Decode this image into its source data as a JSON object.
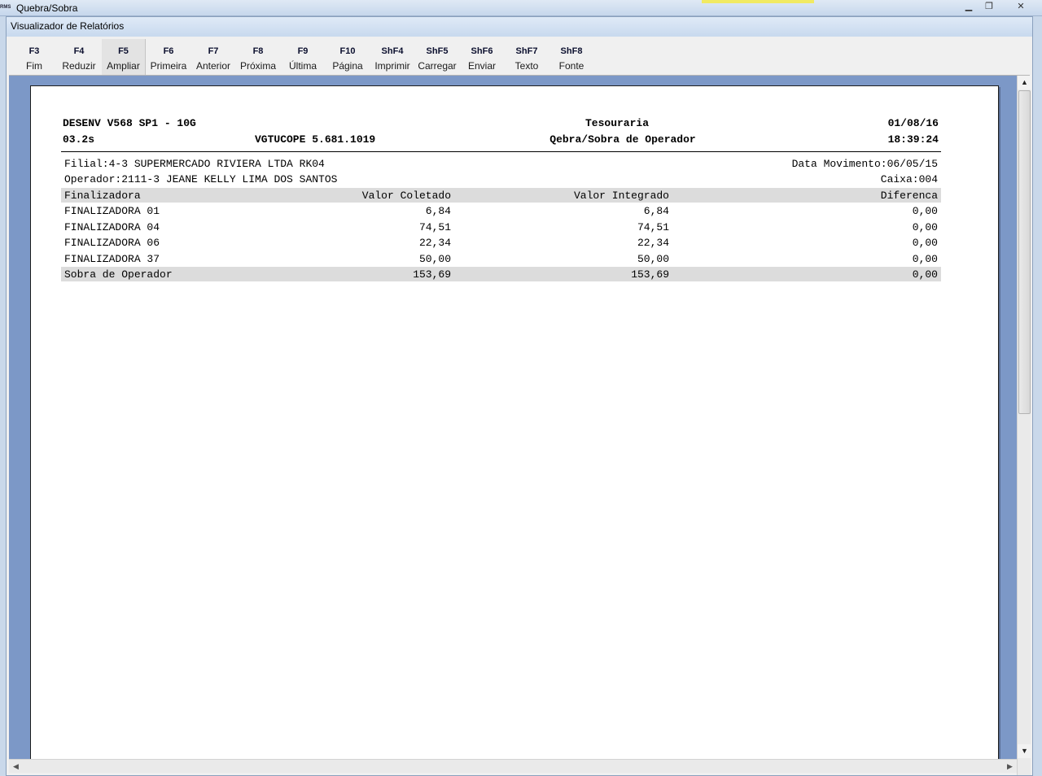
{
  "window": {
    "title": "Quebra/Sobra",
    "app_icon_text": "RMS"
  },
  "dialog": {
    "title": "Visualizador de Relatórios"
  },
  "toolbar": [
    {
      "key": "F3",
      "label": "Fim"
    },
    {
      "key": "F4",
      "label": "Reduzir"
    },
    {
      "key": "F5",
      "label": "Ampliar"
    },
    {
      "key": "F6",
      "label": "Primeira"
    },
    {
      "key": "F7",
      "label": "Anterior"
    },
    {
      "key": "F8",
      "label": "Próxima"
    },
    {
      "key": "F9",
      "label": "Última"
    },
    {
      "key": "F10",
      "label": "Página"
    },
    {
      "key": "ShF4",
      "label": "Imprimir"
    },
    {
      "key": "ShF5",
      "label": "Carregar"
    },
    {
      "key": "ShF6",
      "label": "Enviar"
    },
    {
      "key": "ShF7",
      "label": "Texto"
    },
    {
      "key": "ShF8",
      "label": "Fonte"
    }
  ],
  "report": {
    "system": "DESENV V568 SP1 - 10G",
    "version": "03.2s",
    "program": "VGTUCOPE 5.681.1019",
    "department": "Tesouraria",
    "title": "Qebra/Sobra de Operador",
    "date": "01/08/16",
    "time": "18:39:24",
    "filial": "Filial:4-3 SUPERMERCADO RIVIERA LTDA RK04",
    "data_movimento": "Data Movimento:06/05/15",
    "operador": "Operador:2111-3 JEANE KELLY LIMA DOS SANTOS",
    "caixa": "Caixa:004",
    "columns": [
      "Finalizadora",
      "Valor Coletado",
      "Valor Integrado",
      "Diferenca"
    ],
    "rows": [
      [
        "FINALIZADORA 01",
        "6,84",
        "6,84",
        "0,00"
      ],
      [
        "FINALIZADORA 04",
        "74,51",
        "74,51",
        "0,00"
      ],
      [
        "FINALIZADORA 06",
        "22,34",
        "22,34",
        "0,00"
      ],
      [
        "FINALIZADORA 37",
        "50,00",
        "50,00",
        "0,00"
      ]
    ],
    "total": [
      "Sobra de Operador",
      "153,69",
      "153,69",
      "0,00"
    ]
  }
}
